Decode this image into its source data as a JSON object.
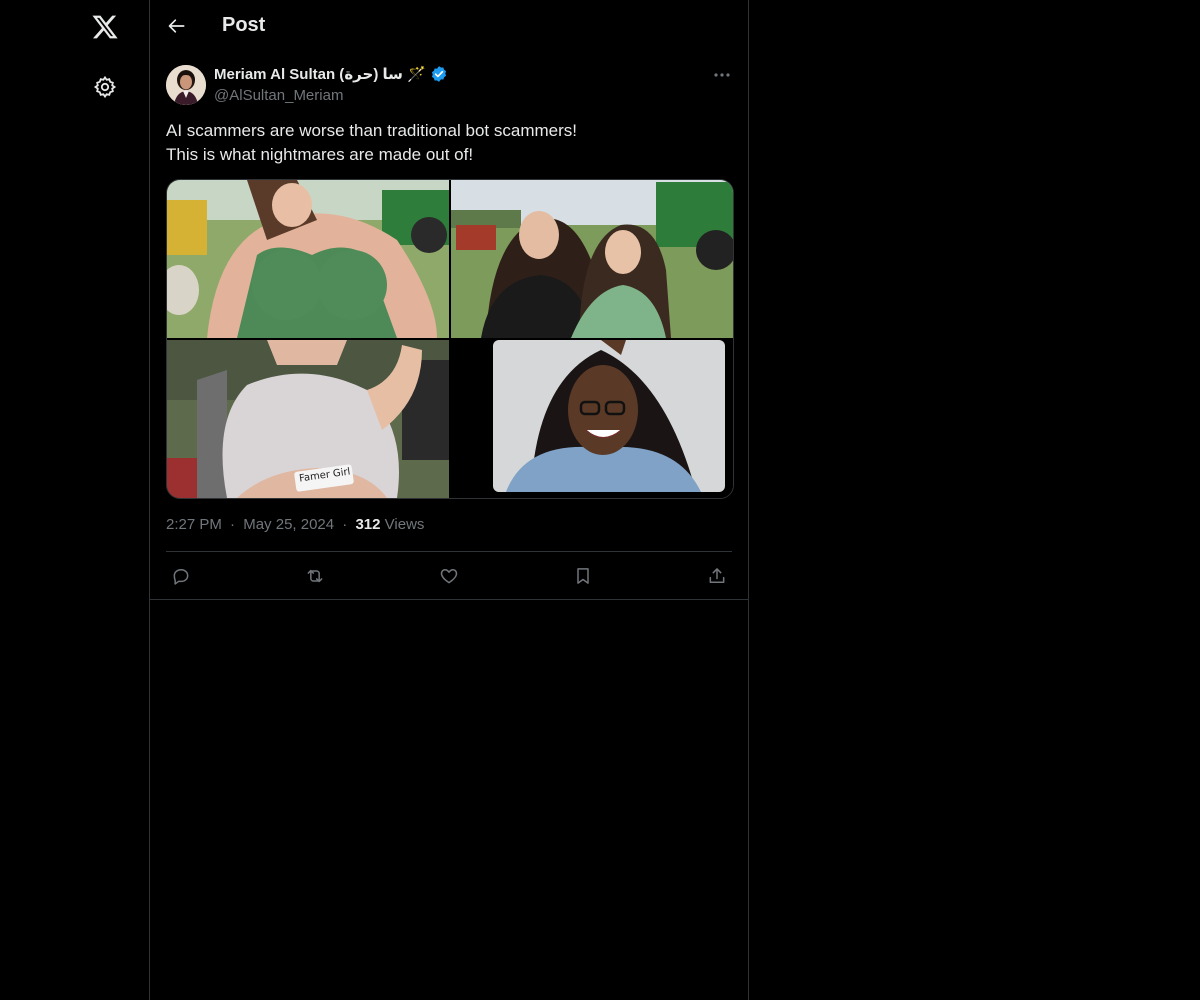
{
  "nav": {
    "logo_icon": "x-logo-icon",
    "settings_icon": "gear-icon"
  },
  "header": {
    "title": "Post",
    "back_icon": "arrow-left-icon"
  },
  "post": {
    "author_name": "Meriam Al Sultan (حرة) سا 🪄",
    "verified_icon": "verified-badge-icon",
    "handle": "@AlSultan_Meriam",
    "text_lines": [
      "AI scammers are worse than traditional bot scammers!",
      "This is what nightmares are made out of!"
    ],
    "media_overlay_text": "Famer Girl",
    "time": "2:27 PM",
    "separator": "·",
    "date": "May 25, 2024",
    "views_count": "312",
    "views_label": "Views"
  },
  "actions": {
    "reply_icon": "reply-icon",
    "repost_icon": "repost-icon",
    "like_icon": "heart-icon",
    "bookmark_icon": "bookmark-icon",
    "share_icon": "share-icon"
  },
  "colors": {
    "background": "#000000",
    "text_primary": "#e7e9ea",
    "text_secondary": "#71767b",
    "border": "#2f3336",
    "verified": "#1d9bf0"
  }
}
